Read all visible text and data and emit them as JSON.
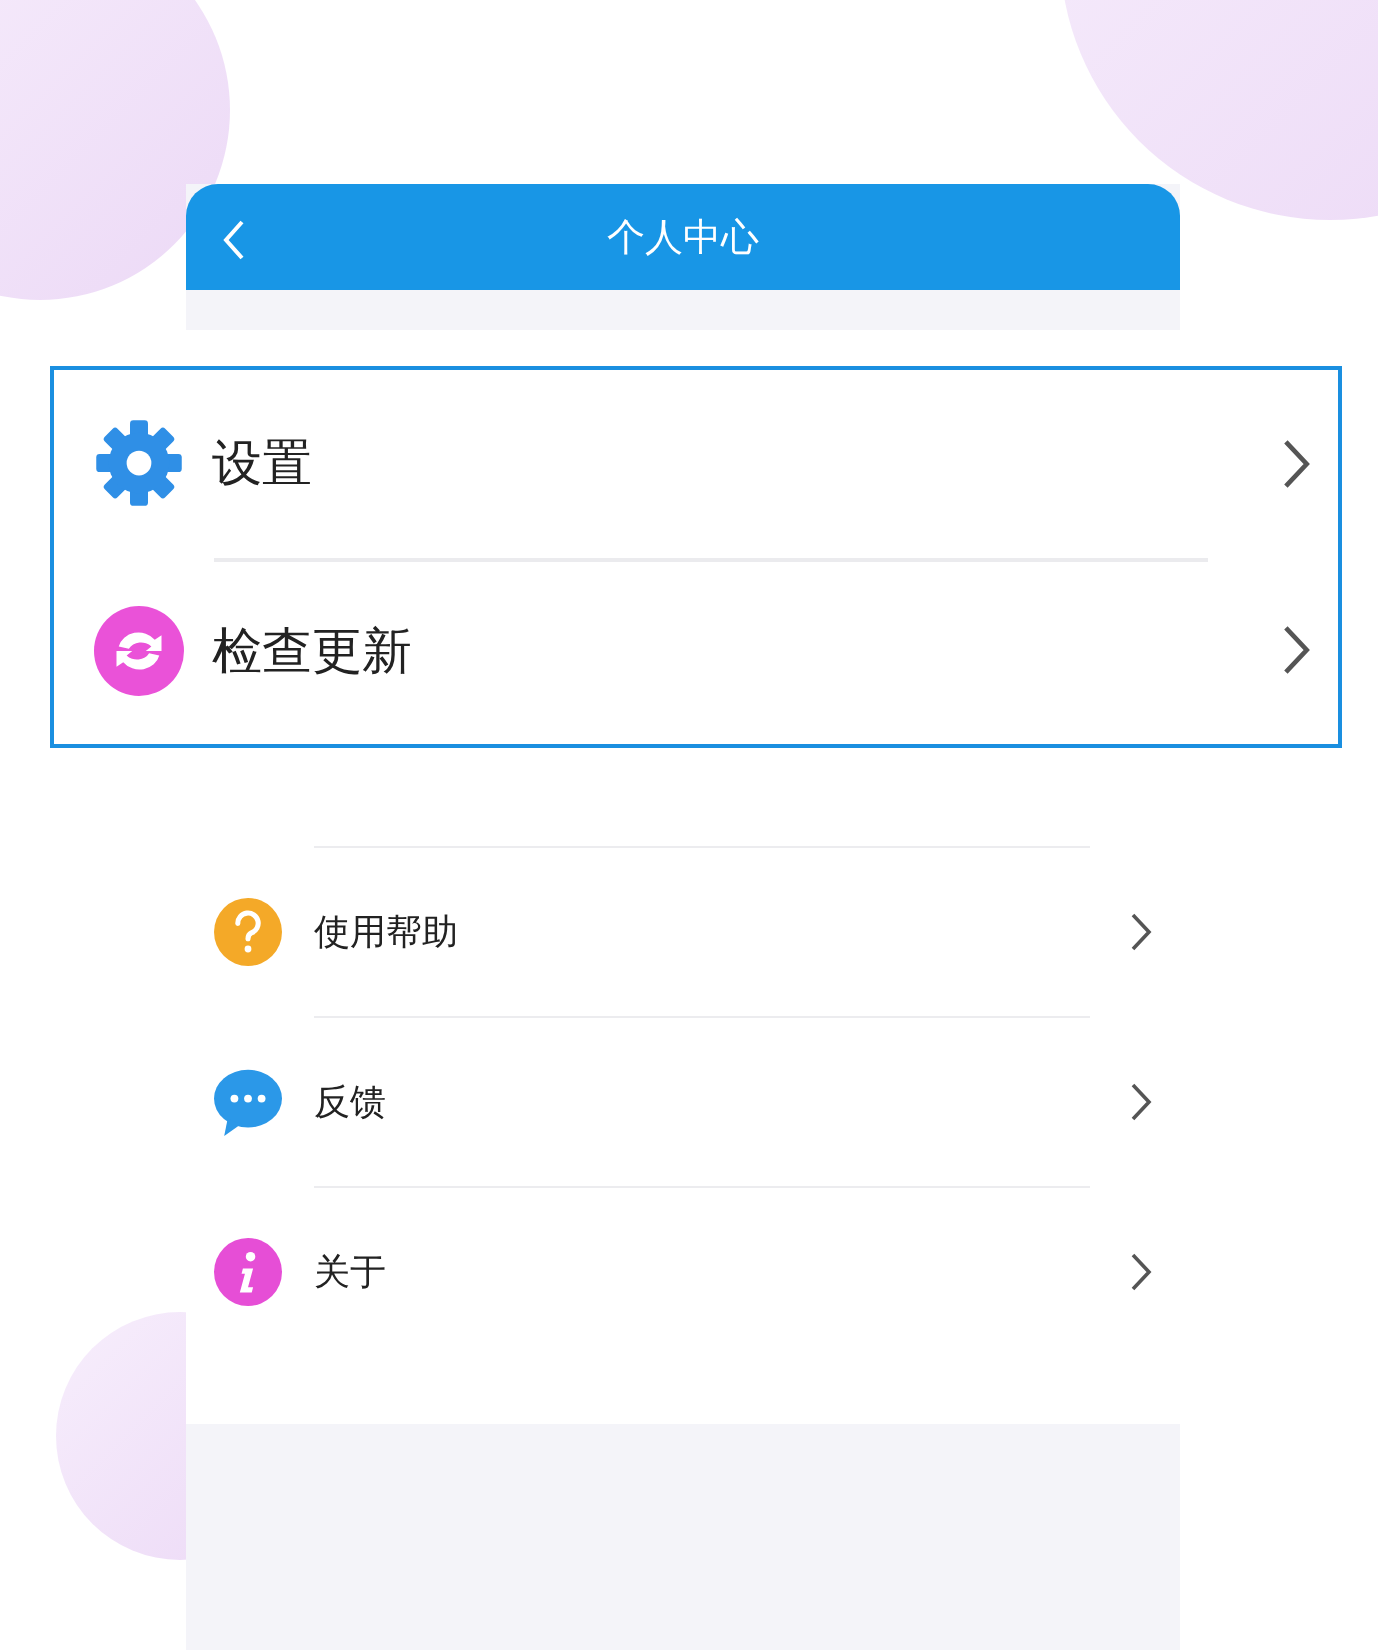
{
  "header": {
    "title": "个人中心"
  },
  "callout": {
    "items": [
      {
        "label": "设置",
        "kind": "settings",
        "color": "#2f8fe6"
      },
      {
        "label": "检查更新",
        "kind": "update",
        "color": "#ea52d8"
      }
    ]
  },
  "menu": {
    "items": [
      {
        "label": "使用帮助",
        "kind": "help",
        "color": "#f4a928"
      },
      {
        "label": "反馈",
        "kind": "feedback",
        "color": "#2b98e8"
      },
      {
        "label": "关于",
        "kind": "about",
        "color": "#e64ed6"
      }
    ]
  }
}
